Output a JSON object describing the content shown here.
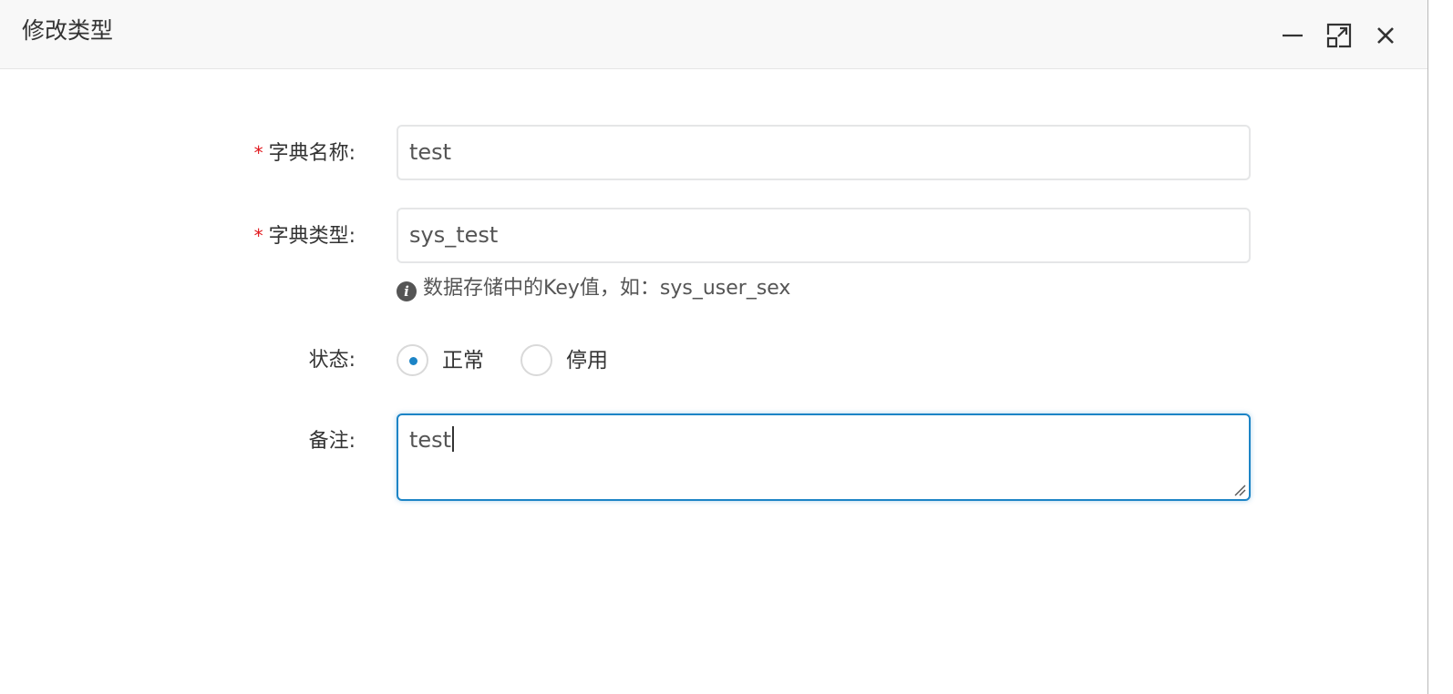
{
  "dialog": {
    "title": "修改类型",
    "controls": {
      "minimize_icon": "minimize-icon",
      "maximize_icon": "maximize-icon",
      "close_icon": "close-icon"
    }
  },
  "form": {
    "dict_name": {
      "required_mark": "*",
      "label": "字典名称:",
      "value": "test"
    },
    "dict_type": {
      "required_mark": "*",
      "label": "字典类型:",
      "value": "sys_test",
      "help_icon": "info-icon",
      "help_text": "数据存储中的Key值，如：sys_user_sex"
    },
    "status": {
      "label": "状态:",
      "options": [
        {
          "label": "正常",
          "checked": true
        },
        {
          "label": "停用",
          "checked": false
        }
      ]
    },
    "remark": {
      "label": "备注:",
      "value": "test"
    }
  },
  "colors": {
    "required": "#e0171c",
    "focus_border": "#1c84c6",
    "radio_dot": "#1c84c6",
    "titlebar_bg": "#f8f8f8"
  }
}
